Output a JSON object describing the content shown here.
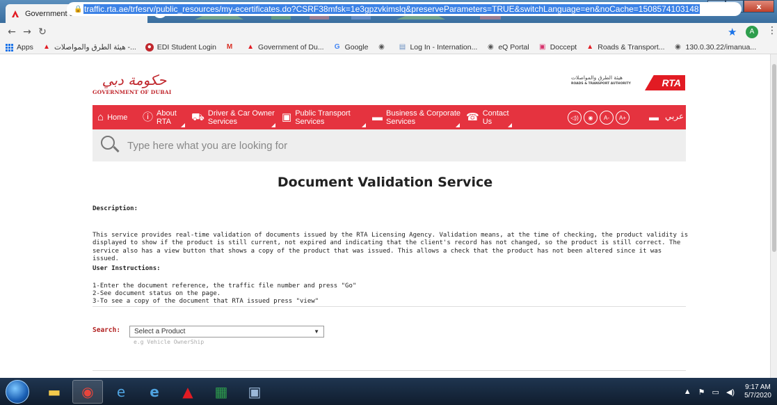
{
  "browser": {
    "tab_title": "Government of Dubai: Road and",
    "tab_close": "×",
    "new_tab": "+",
    "url": "traffic.rta.ae/trfesrv/public_resources/my-ecertificates.do?CSRF38mfsk=1e3gpzvkimslq&preserveParameters=TRUE&switchLanguage=en&noCache=1508574103148",
    "profile_initial": "A",
    "window_controls": {
      "minimize": "—",
      "maximize": "□",
      "close": "x"
    }
  },
  "bookmarks": [
    {
      "label": "Apps",
      "icon": "apps-grid-icon"
    },
    {
      "label": "هيئة الطرق والمواصلات -...",
      "icon": "rta-icon"
    },
    {
      "label": "EDI Student Login",
      "icon": "edi-icon"
    },
    {
      "label": "",
      "icon": "gmail-icon"
    },
    {
      "label": "Government of Du...",
      "icon": "rta-icon"
    },
    {
      "label": "Google",
      "icon": "google-icon"
    },
    {
      "label": "",
      "icon": "globe-icon"
    },
    {
      "label": "Log In - Internation...",
      "icon": "page-icon"
    },
    {
      "label": "eQ Portal",
      "icon": "globe-icon"
    },
    {
      "label": "Doccept",
      "icon": "doccept-icon"
    },
    {
      "label": "Roads & Transport...",
      "icon": "rta-icon"
    },
    {
      "label": "130.0.30.22/imanua...",
      "icon": "globe-icon"
    }
  ],
  "header": {
    "gov_logo_arabic": "حكومة دبي",
    "gov_logo_english": "GOVERNMENT OF DUBAI",
    "rta_arabic": "هيئة الطرق والمواصلات",
    "rta_english": "ROADS & TRANSPORT AUTHORITY",
    "rta_mark": "RTA"
  },
  "nav": {
    "items": [
      {
        "label": "Home",
        "icon": "home-icon",
        "dropdown": false
      },
      {
        "label": "About\nRTA",
        "icon": "info-icon",
        "dropdown": true
      },
      {
        "label": "Driver & Car Owner\nServices",
        "icon": "car-icon",
        "dropdown": true
      },
      {
        "label": "Public Transport\nServices",
        "icon": "bus-icon",
        "dropdown": true
      },
      {
        "label": "Business & Corporate\nServices",
        "icon": "briefcase-icon",
        "dropdown": true
      },
      {
        "label": "Contact\nUs",
        "icon": "phone-icon",
        "dropdown": true
      }
    ],
    "tools": [
      "◁))",
      "◉",
      "A-",
      "A+"
    ],
    "print_icon": "▬",
    "arabic_link": "عربي"
  },
  "search": {
    "placeholder": "Type here what you are looking for"
  },
  "main": {
    "title": "Document Validation Service",
    "description_label": "Description:",
    "description": "This service provides real-time validation of documents issued by the RTA Licensing Agency. Validation means, at the time of checking, the product validity is displayed to show if the product is still current, not expired and indicating that the client's record has not changed, so the product is still correct. The service also has a view button that shows a copy of the product that was issued. This allows a check that the product has not been altered since it was issued.",
    "instructions_label": "User Instructions:",
    "instructions": [
      "1-Enter the document reference, the traffic file number and press \"Go\"",
      "2-See document status on the page.",
      "3-To see a copy of the document that RTA issued press \"view\""
    ],
    "search_label": "Search:",
    "select_value": "Select a Product",
    "select_hint": "e.g Vehicle OwnerShip"
  },
  "taskbar": {
    "time": "9:17 AM",
    "date": "5/7/2020"
  }
}
